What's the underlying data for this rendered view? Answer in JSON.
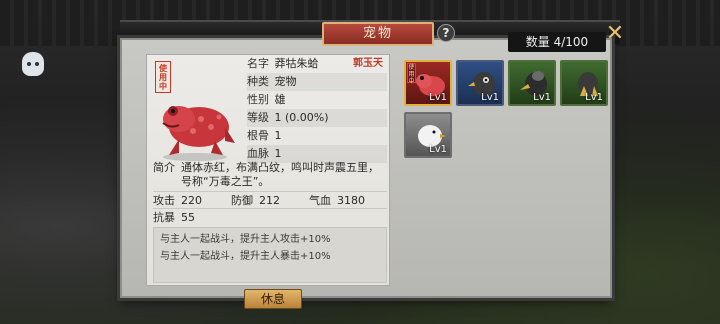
{
  "window": {
    "title": "宠物",
    "count_label": "数量 4/100"
  },
  "detail": {
    "in_use_tag": "使用中",
    "fields": [
      {
        "key": "名字",
        "value": "莽牯朱蛤"
      },
      {
        "key": "种类",
        "value": "宠物"
      },
      {
        "key": "性别",
        "value": "雄"
      },
      {
        "key": "等级",
        "value": "1    (0.00%)"
      },
      {
        "key": "根骨",
        "value": "1"
      },
      {
        "key": "血脉",
        "value": "1"
      }
    ],
    "name_tag": "郭玉天",
    "desc_key": "简介",
    "desc_value": "通体赤红，布满凸纹，鸣叫时声震五里，号称“万毒之王”。",
    "stats": {
      "atk_key": "攻击",
      "atk": "220",
      "def_key": "防御",
      "def": "212",
      "hp_key": "气血",
      "hp": "3180",
      "crit_key": "抗暴",
      "crit": "55"
    },
    "skills": [
      "与主人一起战斗，提升主人攻击+10%",
      "与主人一起战斗，提升主人暴击+10%"
    ]
  },
  "rest_button": "休息",
  "pets": [
    {
      "level": "Lv1",
      "rarity": "red",
      "icon": "toad-icon",
      "in_use": "使用中"
    },
    {
      "level": "Lv1",
      "rarity": "blue",
      "icon": "eagle-icon"
    },
    {
      "level": "Lv1",
      "rarity": "green",
      "icon": "vulture-icon"
    },
    {
      "level": "Lv1",
      "rarity": "green",
      "icon": "falcon-icon"
    },
    {
      "level": "Lv1",
      "rarity": "gray",
      "icon": "white-bird-icon"
    }
  ],
  "colors": {
    "title_tab": "#a83b30",
    "in_use": "#c0392b",
    "rest_button": "#d3a456"
  }
}
